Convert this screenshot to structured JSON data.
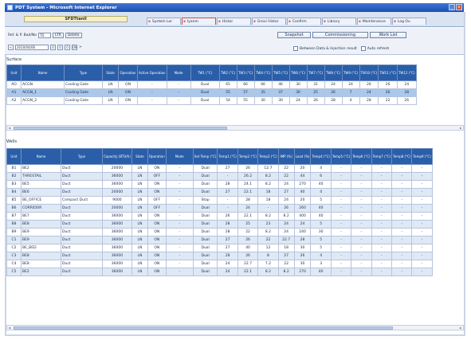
{
  "window": {
    "title": "PDT System - Microsoft Internet Explorer",
    "minimize": "_",
    "close": "x"
  },
  "tabs": {
    "active": "SFDTtanll",
    "items": [
      {
        "label": "System Lor",
        "x": "x",
        "hot": false
      },
      {
        "label": "Iyanm",
        "x": "x",
        "hot": true
      },
      {
        "label": "Histor",
        "x": "x",
        "hot": false
      },
      {
        "label": "Grovi Histor",
        "x": "x",
        "hot": false
      },
      {
        "label": "Confirm",
        "x": "x",
        "hot": false
      },
      {
        "label": "Librory",
        "x": "x",
        "hot": false
      },
      {
        "label": "Maintenance",
        "x": "x",
        "hot": false
      },
      {
        "label": "Log Ou",
        "x": "x",
        "hot": false
      }
    ]
  },
  "toolbar": {
    "row1": {
      "label": "Ref. & P. Bad/No",
      "select": "TD",
      "btn_a": "LTR",
      "btn_b": "Delete"
    },
    "row2": {
      "nav_prev": "<",
      "date": "2010/04/06",
      "sq1": "0",
      "sq2": "0",
      "sq3": "0",
      "sq4": "OK",
      "nav_next": "> "
    },
    "buttons": {
      "snapshot": "Snapshot",
      "commissioning": "Commissioning",
      "work_list": "Work List"
    },
    "checks": {
      "c1": "Between Data & Injection result",
      "c2": "Auto refresh"
    }
  },
  "sections": {
    "upper": "Surface",
    "lower": "Wells"
  },
  "upper_table": {
    "headers": [
      "Unit",
      "Name",
      "Type",
      "State",
      "Operation",
      "Active Operation",
      "Mode",
      "TW1 (°C)",
      "TW2 (°C)",
      "TW3 (°C)",
      "TW4 (°C)",
      "TW5 (°C)",
      "TW6 (°C)",
      "TW7 (°C)",
      "TW8 (°C)",
      "TW9 (°C)",
      "TW10 (°C)",
      "TW11 (°C)",
      "TW12 (°C)"
    ],
    "rows": [
      [
        "AO",
        "ACGN",
        "Cooling Gate",
        "LN",
        "ON",
        "-",
        "-",
        "Dual",
        "65",
        "66",
        "66",
        "46",
        "30",
        "31",
        "24",
        "24",
        "26",
        "26",
        "24"
      ],
      [
        "A1",
        "ACGN_1",
        "Cooling Gate",
        "LN",
        "ON",
        "-",
        "-",
        "Dual",
        "55",
        "57",
        "35",
        "37",
        "30",
        "25",
        "26",
        "7",
        "24",
        "26",
        "28"
      ],
      [
        "A2",
        "ACGN_2",
        "Cooling Gate",
        "LN",
        "ON",
        "-",
        "-",
        "Dual",
        "54",
        "55",
        "30",
        "30",
        "24",
        "26",
        "28",
        "4",
        "28",
        "22",
        "26"
      ]
    ]
  },
  "lower_table": {
    "headers": [
      "Unit",
      "Name",
      "Type",
      "Capacity (BTU/h)",
      "State",
      "Operation",
      "Mode",
      "Set Temp (°C)",
      "Temp1 (°C)",
      "Temp2 (°C)",
      "Temp3 (°C)",
      "IMP (%)",
      "Load (%)",
      "Temp4 (°C)",
      "Temp5 (°C)",
      "Temp6 (°C)",
      "Temp7 (°C)",
      "Temp8 (°C)",
      "Temp9 (°C)"
    ],
    "rows": [
      [
        "B1",
        "BE2",
        "Duct",
        "20000",
        "LN",
        "ON",
        "-",
        "Dual",
        "27",
        "26",
        "12.7",
        "22",
        "20",
        "4",
        "-",
        "-",
        "-",
        "-",
        "-"
      ],
      [
        "B2",
        "THRESTAIL",
        "Duct",
        "36000",
        "LN",
        "OFF",
        "-",
        "Dual",
        "-",
        "26.2",
        "8.2",
        "22",
        "44",
        "6",
        "-",
        "-",
        "-",
        "-",
        "-"
      ],
      [
        "B3",
        "BE5",
        "Duct",
        "36000",
        "LN",
        "ON",
        "-",
        "Dual",
        "28",
        "24.1",
        "8.2",
        "24",
        "270",
        "40",
        "-",
        "-",
        "-",
        "-",
        "-"
      ],
      [
        "B4",
        "BE6",
        "Duct",
        "20000",
        "LN",
        "ON",
        "-",
        "Dual",
        "27",
        "22.1",
        "18",
        "27",
        "40",
        "4",
        "-",
        "-",
        "-",
        "-",
        "-"
      ],
      [
        "B5",
        "BE_OFFICE",
        "Compact Duct",
        "9000",
        "LN",
        "OFF",
        "-",
        "Stop",
        "-",
        "28",
        "18",
        "24",
        "20",
        "5",
        "-",
        "-",
        "-",
        "-",
        "-"
      ],
      [
        "B6",
        "CORRIDOR",
        "Duct",
        "20000",
        "LN",
        "OFF",
        "-",
        "Dual",
        "-",
        "24",
        "-",
        "26",
        "260",
        "40",
        "-",
        "-",
        "-",
        "-",
        "-"
      ],
      [
        "B7",
        "BE7",
        "Duct",
        "36000",
        "LN",
        "ON",
        "-",
        "Dual",
        "26",
        "22.1",
        "8.2",
        "8.2",
        "400",
        "40",
        "-",
        "-",
        "-",
        "-",
        "-"
      ],
      [
        "B8",
        "BE8",
        "Duct",
        "36000",
        "LN",
        "ON",
        "-",
        "Dual",
        "28",
        "25",
        "23",
        "24",
        "24",
        "5",
        "-",
        "-",
        "-",
        "-",
        "-"
      ],
      [
        "B9",
        "BE9",
        "Duct",
        "36000",
        "LN",
        "ON",
        "-",
        "Dual",
        "28",
        "22",
        "8.2",
        "24",
        "240",
        "30",
        "-",
        "-",
        "-",
        "-",
        "-"
      ],
      [
        "C1",
        "BE9",
        "Duct",
        "36000",
        "LN",
        "ON",
        "-",
        "Dual",
        "27",
        "26",
        "22",
        "22.7",
        "28",
        "5",
        "-",
        "-",
        "-",
        "-",
        "-"
      ],
      [
        "C2",
        "BE_BED",
        "Duct",
        "36000",
        "LN",
        "ON",
        "-",
        "Dual",
        "27",
        "40",
        "12",
        "18",
        "30",
        "5",
        "-",
        "-",
        "-",
        "-",
        "-"
      ],
      [
        "C3",
        "BE8",
        "Duct",
        "36000",
        "LN",
        "ON",
        "-",
        "Dual",
        "28",
        "26",
        "8",
        "27",
        "26",
        "4",
        "-",
        "-",
        "-",
        "-",
        "-"
      ],
      [
        "C4",
        "BE8",
        "Duct",
        "36000",
        "LN",
        "ON",
        "-",
        "Dual",
        "24",
        "22.7",
        "7.2",
        "22",
        "30",
        "3",
        "-",
        "-",
        "-",
        "-",
        "-"
      ],
      [
        "C5",
        "BE2",
        "Duct",
        "36000",
        "LN",
        "ON",
        "-",
        "Dual",
        "24",
        "22.1",
        "8.2",
        "8.2",
        "270",
        "40",
        "-",
        "-",
        "-",
        "-",
        "-"
      ]
    ]
  },
  "scroll": {
    "left_arrow": "◂",
    "right_arrow": "▸"
  }
}
